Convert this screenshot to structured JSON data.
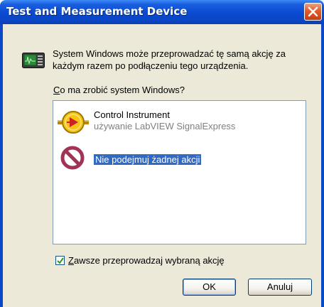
{
  "window": {
    "title": "Test and Measurement Device",
    "close_icon": "close-icon"
  },
  "description": "System Windows może przeprowadzać tę samą akcję za każdym razem po podłączeniu tego urządzenia.",
  "question": {
    "accel": "C",
    "rest": "o ma zrobić system Windows?"
  },
  "options": [
    {
      "icon": "labview-control-instrument-icon",
      "title": "Control Instrument",
      "subtitle": "używanie LabVIEW SignalExpress"
    },
    {
      "icon": "no-action-icon",
      "title": "Nie podejmuj żadnej akcji",
      "selected": true
    }
  ],
  "checkbox": {
    "accel": "Z",
    "rest": "awsze przeprowadzaj wybraną akcję",
    "checked": true
  },
  "buttons": {
    "ok": "OK",
    "cancel": "Anuluj"
  },
  "colors": {
    "titlebar": "#0a49d1",
    "selection": "#316ac5",
    "close_button": "#e35a2a"
  }
}
